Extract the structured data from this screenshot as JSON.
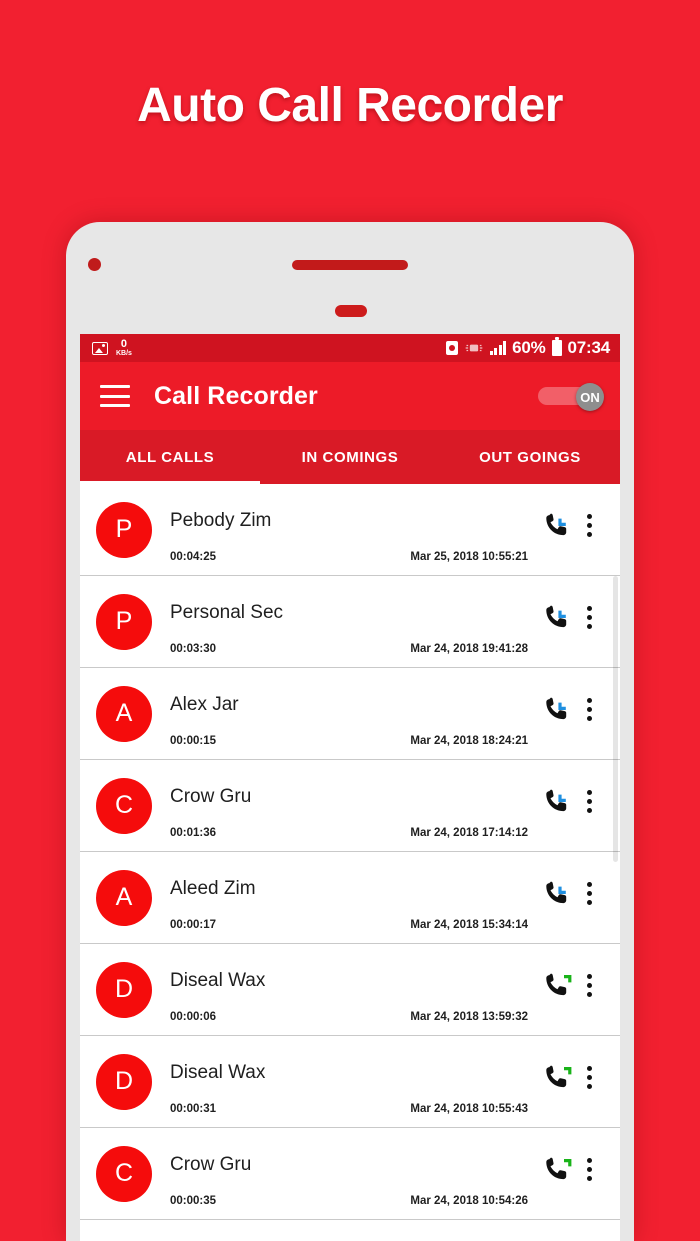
{
  "promo": {
    "title": "Auto Call Recorder"
  },
  "status_bar": {
    "network_speed_value": "0",
    "network_speed_unit": "KB/s",
    "battery_percent": "60%",
    "clock": "07:34",
    "icons": [
      "image-icon",
      "alarm-icon",
      "vibrate-icon",
      "signal-icon",
      "battery-icon"
    ]
  },
  "app_bar": {
    "title": "Call Recorder",
    "menu_icon": "hamburger-menu-icon",
    "toggle_label": "ON",
    "toggle_state": "on"
  },
  "tabs": [
    {
      "label": "ALL CALLS",
      "active": true
    },
    {
      "label": "IN COMINGS",
      "active": false
    },
    {
      "label": "OUT GOINGS",
      "active": false
    }
  ],
  "calls": [
    {
      "initial": "P",
      "name": "Pebody Zim",
      "duration": "00:04:25",
      "date": "Mar 25, 2018",
      "time": "10:55:21",
      "type": "incoming"
    },
    {
      "initial": "P",
      "name": "Personal Sec",
      "duration": "00:03:30",
      "date": "Mar 24, 2018",
      "time": "19:41:28",
      "type": "incoming"
    },
    {
      "initial": "A",
      "name": "Alex Jar",
      "duration": "00:00:15",
      "date": "Mar 24, 2018",
      "time": "18:24:21",
      "type": "incoming"
    },
    {
      "initial": "C",
      "name": "Crow Gru",
      "duration": "00:01:36",
      "date": "Mar 24, 2018",
      "time": "17:14:12",
      "type": "incoming"
    },
    {
      "initial": "A",
      "name": "Aleed Zim",
      "duration": "00:00:17",
      "date": "Mar 24, 2018",
      "time": "15:34:14",
      "type": "incoming"
    },
    {
      "initial": "D",
      "name": "Diseal Wax",
      "duration": "00:00:06",
      "date": "Mar 24, 2018",
      "time": "13:59:32",
      "type": "outgoing"
    },
    {
      "initial": "D",
      "name": "Diseal Wax",
      "duration": "00:00:31",
      "date": "Mar 24, 2018",
      "time": "10:55:43",
      "type": "outgoing"
    },
    {
      "initial": "C",
      "name": "Crow Gru",
      "duration": "00:00:35",
      "date": "Mar 24, 2018",
      "time": "10:54:26",
      "type": "outgoing"
    }
  ],
  "colors": {
    "background_red": "#f22030",
    "status_bar_red": "#cf1320",
    "app_bar_red": "#ed1b28",
    "tab_bar_red": "#d91a26",
    "avatar_red": "#f50c0c",
    "incoming_arrow": "#1f8fe0",
    "outgoing_arrow": "#19b319",
    "phone_bezel": "#e7e7e7"
  }
}
